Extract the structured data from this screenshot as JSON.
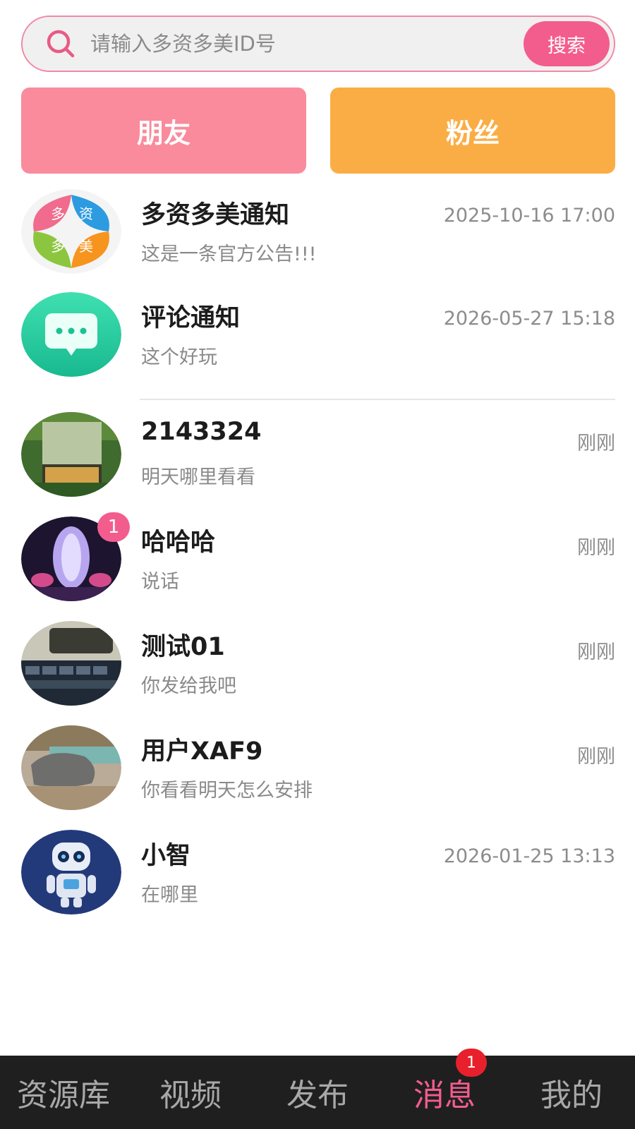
{
  "search": {
    "placeholder": "请输入多资多美ID号",
    "button_label": "搜索"
  },
  "tabs": {
    "friends": "朋友",
    "fans": "粉丝"
  },
  "messages": [
    {
      "name": "多资多美通知",
      "preview": "这是一条官方公告!!!",
      "time": "2025-10-16 17:00",
      "avatar": "logo-icon",
      "logo_chars": [
        "多",
        "资",
        "多",
        "美"
      ]
    },
    {
      "name": "评论通知",
      "preview": "这个好玩",
      "time": "2026-05-27 15:18",
      "avatar": "comment-bubble-icon"
    },
    {
      "name": "2143324",
      "preview": "明天哪里看看",
      "time": "刚刚",
      "avatar": "photo-box"
    },
    {
      "name": "哈哈哈",
      "preview": "说话",
      "time": "刚刚",
      "avatar": "photo-fountain",
      "unread": "1"
    },
    {
      "name": "测试01",
      "preview": "你发给我吧",
      "time": "刚刚",
      "avatar": "photo-keyboard"
    },
    {
      "name": "用户XAF9",
      "preview": "你看看明天怎么安排",
      "time": "刚刚",
      "avatar": "photo-rocks"
    },
    {
      "name": "小智",
      "preview": "在哪里",
      "time": "2026-01-25 13:13",
      "avatar": "robot-icon"
    }
  ],
  "nav": {
    "items": [
      "资源库",
      "视频",
      "发布",
      "消息",
      "我的"
    ],
    "active": "消息",
    "badge": "1"
  },
  "colors": {
    "accent": "#f25d8e",
    "friends_tab": "#f98b9c",
    "fans_tab": "#fbad45",
    "nav_bg": "#1f1f1f"
  }
}
